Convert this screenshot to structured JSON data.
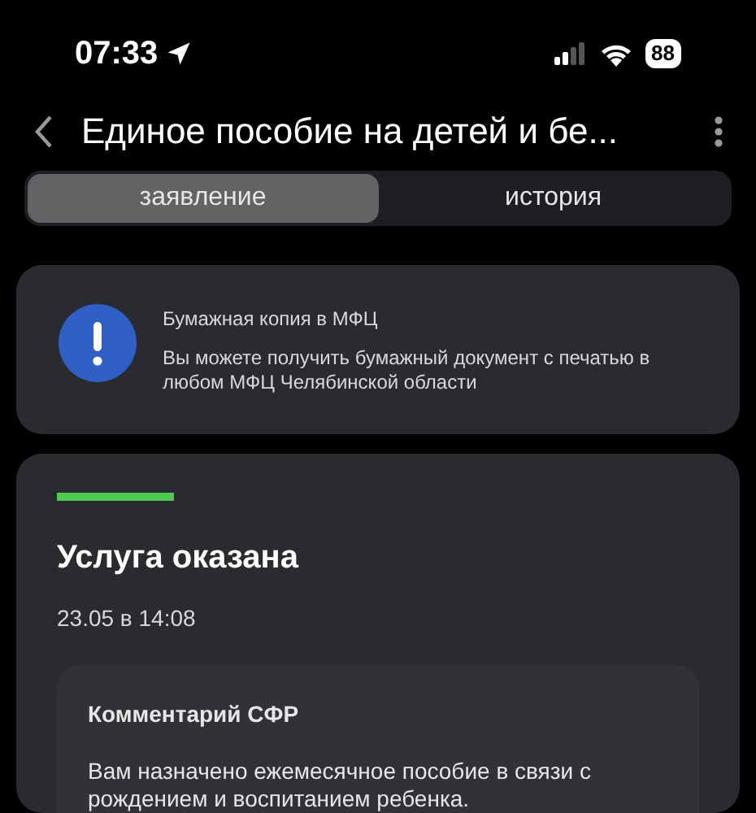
{
  "status_bar": {
    "time": "07:33",
    "battery": "88"
  },
  "header": {
    "title": "Единое пособие на детей и бе..."
  },
  "tabs": [
    {
      "label": "заявление",
      "selected": true
    },
    {
      "label": "история",
      "selected": false
    }
  ],
  "notice": {
    "title": "Бумажная копия в МФЦ",
    "text": "Вы можете получить бумажный документ с печатью в любом МФЦ Челябинской области"
  },
  "status_card": {
    "title": "Услуга оказана",
    "date": "23.05 в 14:08",
    "comment": {
      "title": "Комментарий СФР",
      "text": "Вам назначено ежемесячное пособие в связи с рождением и воспитанием ребенка."
    }
  }
}
